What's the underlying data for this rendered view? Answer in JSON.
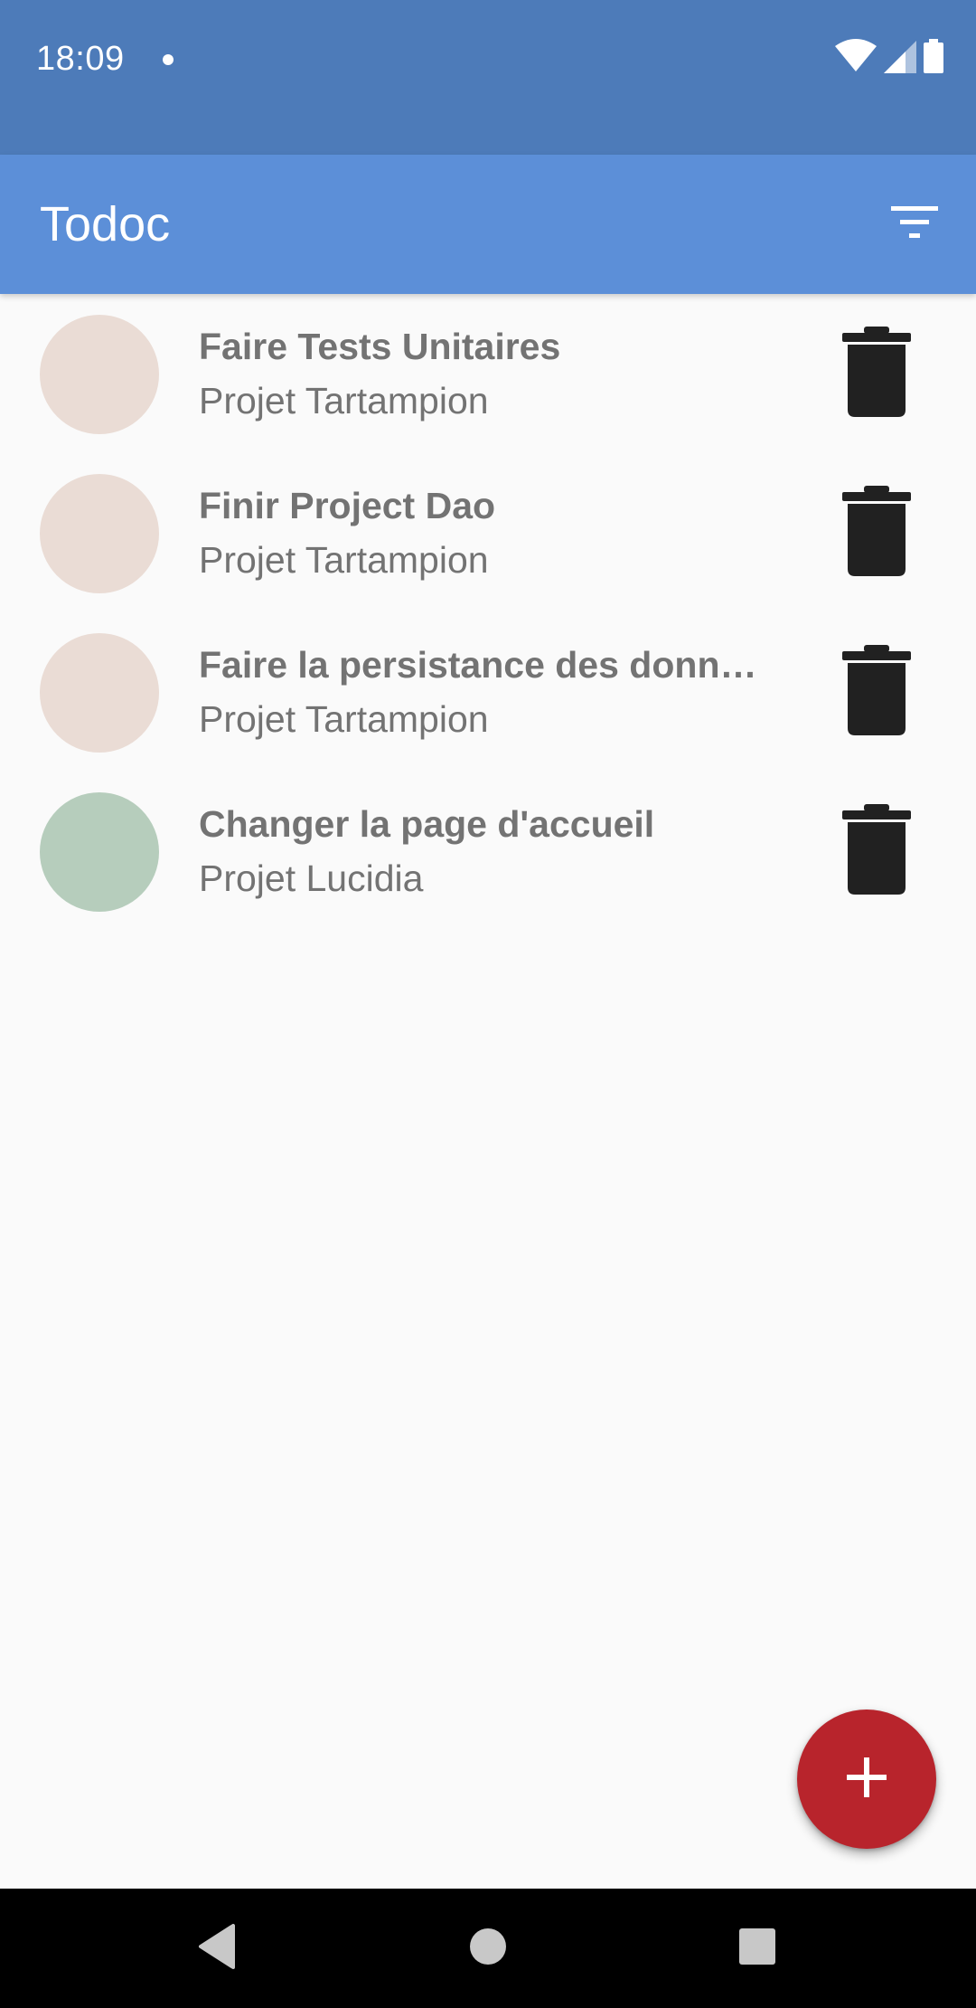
{
  "status_bar": {
    "time": "18:09",
    "icons": [
      "notification-dot-icon",
      "wifi-icon",
      "signal-icon",
      "battery-icon"
    ],
    "background": "#4d7bb9"
  },
  "app_bar": {
    "title": "Todoc",
    "action_icon": "filter-icon",
    "background": "#5c8fd8"
  },
  "tasks": [
    {
      "name": "Faire Tests Unitaires",
      "project": "Projet Tartampion",
      "project_color": "#eadcd5",
      "action_icon": "trash-icon"
    },
    {
      "name": "Finir Project Dao",
      "project": "Projet Tartampion",
      "project_color": "#eadcd5",
      "action_icon": "trash-icon"
    },
    {
      "name": "Faire la persistance des donn…",
      "project": "Projet Tartampion",
      "project_color": "#eadcd5",
      "action_icon": "trash-icon"
    },
    {
      "name": "Changer la page d'accueil",
      "project": "Projet Lucidia",
      "project_color": "#b6cdbc",
      "action_icon": "trash-icon"
    }
  ],
  "fab": {
    "icon": "plus-icon",
    "color": "#b8242c"
  },
  "nav_bar": {
    "icons": [
      "back-icon",
      "home-icon",
      "recents-icon"
    ]
  }
}
